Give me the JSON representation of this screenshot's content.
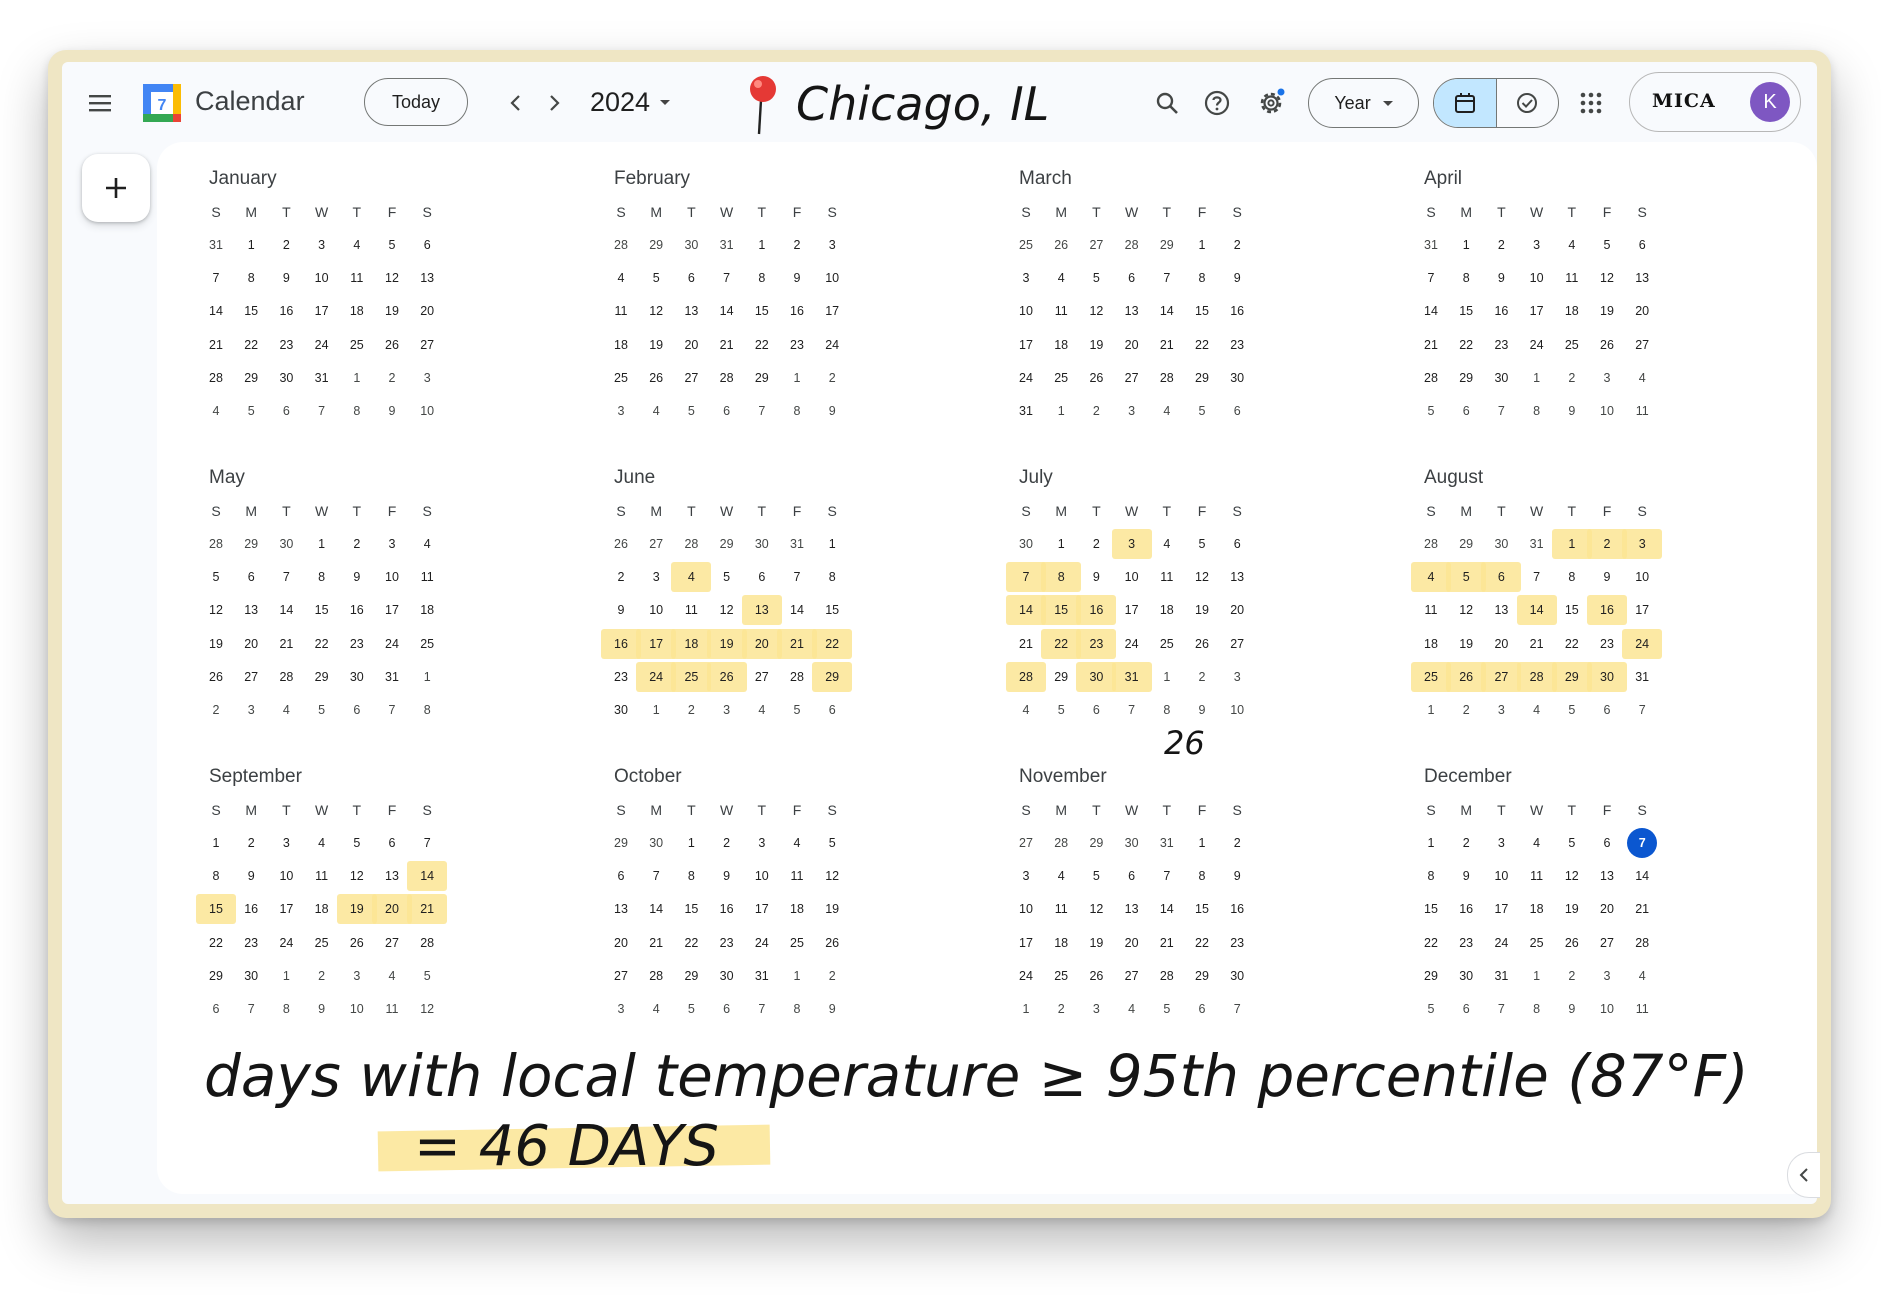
{
  "app": {
    "title": "Calendar",
    "logo_number": "7"
  },
  "toolbar": {
    "today_label": "Today",
    "year": "2024",
    "view_label": "Year"
  },
  "account": {
    "brand": "MICA",
    "avatar_initial": "K"
  },
  "weekday_headers": [
    "S",
    "M",
    "T",
    "W",
    "T",
    "F",
    "S"
  ],
  "months": [
    {
      "name": "January",
      "first": "12-31",
      "weeks": [
        [
          "31",
          "1",
          "2",
          "3",
          "4",
          "5",
          "6"
        ],
        [
          "7",
          "8",
          "9",
          "10",
          "11",
          "12",
          "13"
        ],
        [
          "14",
          "15",
          "16",
          "17",
          "18",
          "19",
          "20"
        ],
        [
          "21",
          "22",
          "23",
          "24",
          "25",
          "26",
          "27"
        ],
        [
          "28",
          "29",
          "30",
          "31",
          "1",
          "2",
          "3"
        ],
        [
          "4",
          "5",
          "6",
          "7",
          "8",
          "9",
          "10"
        ]
      ]
    },
    {
      "name": "February",
      "weeks": [
        [
          "28",
          "29",
          "30",
          "31",
          "1",
          "2",
          "3"
        ],
        [
          "4",
          "5",
          "6",
          "7",
          "8",
          "9",
          "10"
        ],
        [
          "11",
          "12",
          "13",
          "14",
          "15",
          "16",
          "17"
        ],
        [
          "18",
          "19",
          "20",
          "21",
          "22",
          "23",
          "24"
        ],
        [
          "25",
          "26",
          "27",
          "28",
          "29",
          "1",
          "2"
        ],
        [
          "3",
          "4",
          "5",
          "6",
          "7",
          "8",
          "9"
        ]
      ]
    },
    {
      "name": "March",
      "weeks": [
        [
          "25",
          "26",
          "27",
          "28",
          "29",
          "1",
          "2"
        ],
        [
          "3",
          "4",
          "5",
          "6",
          "7",
          "8",
          "9"
        ],
        [
          "10",
          "11",
          "12",
          "13",
          "14",
          "15",
          "16"
        ],
        [
          "17",
          "18",
          "19",
          "20",
          "21",
          "22",
          "23"
        ],
        [
          "24",
          "25",
          "26",
          "27",
          "28",
          "29",
          "30"
        ],
        [
          "31",
          "1",
          "2",
          "3",
          "4",
          "5",
          "6"
        ]
      ]
    },
    {
      "name": "April",
      "weeks": [
        [
          "31",
          "1",
          "2",
          "3",
          "4",
          "5",
          "6"
        ],
        [
          "7",
          "8",
          "9",
          "10",
          "11",
          "12",
          "13"
        ],
        [
          "14",
          "15",
          "16",
          "17",
          "18",
          "19",
          "20"
        ],
        [
          "21",
          "22",
          "23",
          "24",
          "25",
          "26",
          "27"
        ],
        [
          "28",
          "29",
          "30",
          "1",
          "2",
          "3",
          "4"
        ],
        [
          "5",
          "6",
          "7",
          "8",
          "9",
          "10",
          "11"
        ]
      ]
    },
    {
      "name": "May",
      "weeks": [
        [
          "28",
          "29",
          "30",
          "1",
          "2",
          "3",
          "4"
        ],
        [
          "5",
          "6",
          "7",
          "8",
          "9",
          "10",
          "11"
        ],
        [
          "12",
          "13",
          "14",
          "15",
          "16",
          "17",
          "18"
        ],
        [
          "19",
          "20",
          "21",
          "22",
          "23",
          "24",
          "25"
        ],
        [
          "26",
          "27",
          "28",
          "29",
          "30",
          "31",
          "1"
        ],
        [
          "2",
          "3",
          "4",
          "5",
          "6",
          "7",
          "8"
        ]
      ]
    },
    {
      "name": "June",
      "weeks": [
        [
          "26",
          "27",
          "28",
          "29",
          "30",
          "31",
          "1"
        ],
        [
          "2",
          "3",
          "4",
          "5",
          "6",
          "7",
          "8"
        ],
        [
          "9",
          "10",
          "11",
          "12",
          "13",
          "14",
          "15"
        ],
        [
          "16",
          "17",
          "18",
          "19",
          "20",
          "21",
          "22"
        ],
        [
          "23",
          "24",
          "25",
          "26",
          "27",
          "28",
          "29"
        ],
        [
          "30",
          "1",
          "2",
          "3",
          "4",
          "5",
          "6"
        ]
      ]
    },
    {
      "name": "July",
      "weeks": [
        [
          "30",
          "1",
          "2",
          "3",
          "4",
          "5",
          "6"
        ],
        [
          "7",
          "8",
          "9",
          "10",
          "11",
          "12",
          "13"
        ],
        [
          "14",
          "15",
          "16",
          "17",
          "18",
          "19",
          "20"
        ],
        [
          "21",
          "22",
          "23",
          "24",
          "25",
          "26",
          "27"
        ],
        [
          "28",
          "29",
          "30",
          "31",
          "1",
          "2",
          "3"
        ],
        [
          "4",
          "5",
          "6",
          "7",
          "8",
          "9",
          "10"
        ]
      ]
    },
    {
      "name": "August",
      "weeks": [
        [
          "28",
          "29",
          "30",
          "31",
          "1",
          "2",
          "3"
        ],
        [
          "4",
          "5",
          "6",
          "7",
          "8",
          "9",
          "10"
        ],
        [
          "11",
          "12",
          "13",
          "14",
          "15",
          "16",
          "17"
        ],
        [
          "18",
          "19",
          "20",
          "21",
          "22",
          "23",
          "24"
        ],
        [
          "25",
          "26",
          "27",
          "28",
          "29",
          "30",
          "31"
        ],
        [
          "1",
          "2",
          "3",
          "4",
          "5",
          "6",
          "7"
        ]
      ]
    },
    {
      "name": "September",
      "weeks": [
        [
          "1",
          "2",
          "3",
          "4",
          "5",
          "6",
          "7"
        ],
        [
          "8",
          "9",
          "10",
          "11",
          "12",
          "13",
          "14"
        ],
        [
          "15",
          "16",
          "17",
          "18",
          "19",
          "20",
          "21"
        ],
        [
          "22",
          "23",
          "24",
          "25",
          "26",
          "27",
          "28"
        ],
        [
          "29",
          "30",
          "1",
          "2",
          "3",
          "4",
          "5"
        ],
        [
          "6",
          "7",
          "8",
          "9",
          "10",
          "11",
          "12"
        ]
      ]
    },
    {
      "name": "October",
      "weeks": [
        [
          "29",
          "30",
          "1",
          "2",
          "3",
          "4",
          "5"
        ],
        [
          "6",
          "7",
          "8",
          "9",
          "10",
          "11",
          "12"
        ],
        [
          "13",
          "14",
          "15",
          "16",
          "17",
          "18",
          "19"
        ],
        [
          "20",
          "21",
          "22",
          "23",
          "24",
          "25",
          "26"
        ],
        [
          "27",
          "28",
          "29",
          "30",
          "31",
          "1",
          "2"
        ],
        [
          "3",
          "4",
          "5",
          "6",
          "7",
          "8",
          "9"
        ]
      ]
    },
    {
      "name": "November",
      "weeks": [
        [
          "27",
          "28",
          "29",
          "30",
          "31",
          "1",
          "2"
        ],
        [
          "3",
          "4",
          "5",
          "6",
          "7",
          "8",
          "9"
        ],
        [
          "10",
          "11",
          "12",
          "13",
          "14",
          "15",
          "16"
        ],
        [
          "17",
          "18",
          "19",
          "20",
          "21",
          "22",
          "23"
        ],
        [
          "24",
          "25",
          "26",
          "27",
          "28",
          "29",
          "30"
        ],
        [
          "1",
          "2",
          "3",
          "4",
          "5",
          "6",
          "7"
        ]
      ]
    },
    {
      "name": "December",
      "weeks": [
        [
          "1",
          "2",
          "3",
          "4",
          "5",
          "6",
          "7"
        ],
        [
          "8",
          "9",
          "10",
          "11",
          "12",
          "13",
          "14"
        ],
        [
          "15",
          "16",
          "17",
          "18",
          "19",
          "20",
          "21"
        ],
        [
          "22",
          "23",
          "24",
          "25",
          "26",
          "27",
          "28"
        ],
        [
          "29",
          "30",
          "31",
          "1",
          "2",
          "3",
          "4"
        ],
        [
          "5",
          "6",
          "7",
          "8",
          "9",
          "10",
          "11"
        ]
      ]
    }
  ],
  "highlighted_days": {
    "June": [
      4,
      13,
      16,
      17,
      18,
      19,
      20,
      21,
      22,
      24,
      25,
      26,
      29
    ],
    "July": [
      3,
      7,
      8,
      14,
      15,
      16,
      22,
      23,
      28,
      30,
      31
    ],
    "August": [
      1,
      2,
      3,
      4,
      5,
      6,
      14,
      16,
      24,
      25,
      26,
      27,
      28,
      29,
      30
    ],
    "September": [
      14,
      15,
      19,
      20,
      21
    ]
  },
  "today": {
    "month": "December",
    "day": 7
  },
  "annotations": {
    "location": "Chicago, IL",
    "july_count": "26",
    "caption": "days with local temperature ≥ 95th percentile (87°F)",
    "total": "= 46 DAYS"
  },
  "colors": {
    "highlight": "#fce594",
    "today": "#0b57d0",
    "avatar": "#7e57c2",
    "toggle_active": "#c2e7ff"
  }
}
